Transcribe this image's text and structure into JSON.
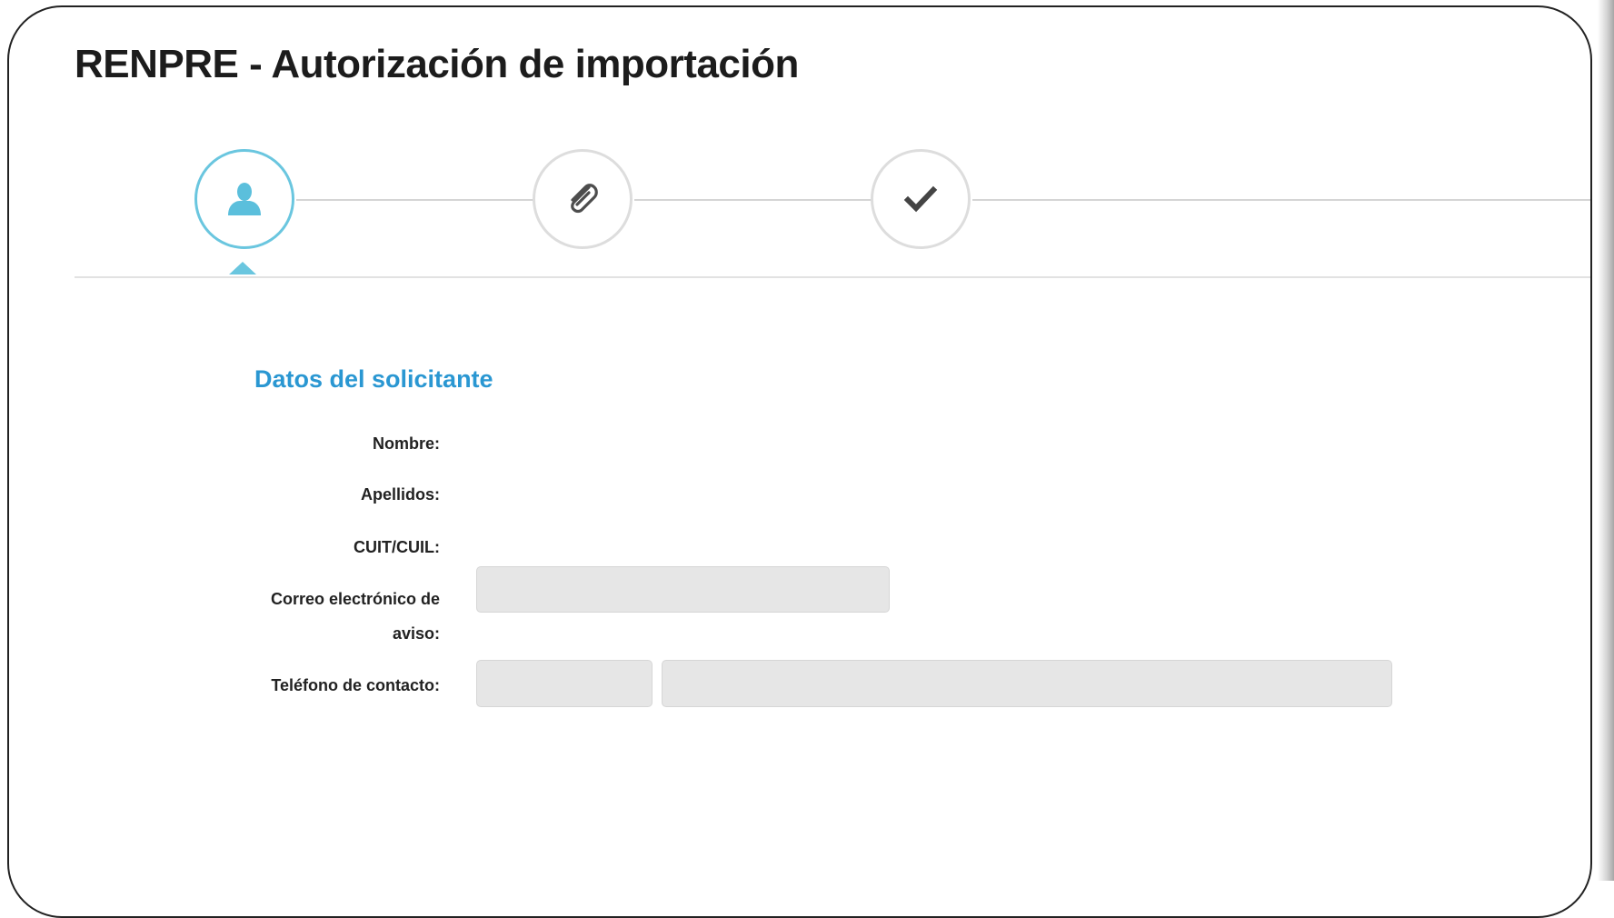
{
  "page": {
    "title": "RENPRE - Autorización de importación"
  },
  "stepper": {
    "steps": [
      {
        "icon": "user-icon",
        "state": "active"
      },
      {
        "icon": "paperclip-icon",
        "state": "inactive"
      },
      {
        "icon": "checkmark-icon",
        "state": "inactive"
      }
    ],
    "active_color": "#6ac6df"
  },
  "form": {
    "section_title": "Datos del solicitante",
    "fields": {
      "nombre_label": "Nombre:",
      "apellidos_label": "Apellidos:",
      "cuit_label": "CUIT/CUIL:",
      "correo_label_line1": "Correo electrónico de",
      "correo_label_line2": "aviso:",
      "correo_value": "",
      "telefono_label": "Teléfono de contacto:",
      "telefono_area_value": "",
      "telefono_number_value": ""
    }
  },
  "colors": {
    "section_title": "#2a97d2",
    "title_text": "#1c1c1c",
    "input_background": "#e6e6e6"
  }
}
